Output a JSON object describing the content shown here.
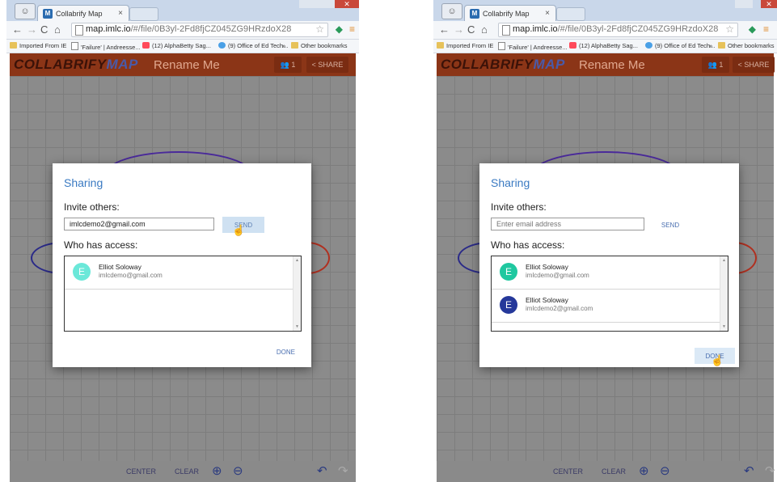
{
  "browser": {
    "tab_title": "Collabrify Map",
    "url_host": "map.imlc.io",
    "url_path": "/#/file/0B3yl-2Fd8fjCZ045ZG9HRzdoX28",
    "bookmarks": [
      "Imported From IE",
      "'Failure' | Andreesse...",
      "(12) AlphaBetty Sag...",
      "(9) Office of Ed Tech...",
      "Other bookmarks"
    ],
    "overflow": "»"
  },
  "app": {
    "logo_prefix": "COLLABRIFY",
    "logo_suffix": "MAP",
    "doc_title": "Rename Me",
    "user_count": "1",
    "share_label": "SHARE",
    "toolbar": {
      "center_label": "CENTER",
      "clear_label": "CLEAR"
    },
    "colors": {
      "header": "#8b3517",
      "accent": "#3a7ac2",
      "ellipse_purple": "#4a2a9a",
      "ellipse_blue": "#2a2a88",
      "ellipse_red": "#b03020"
    }
  },
  "dialog": {
    "title": "Sharing",
    "invite_label": "Invite others:",
    "email_placeholder": "Enter email address",
    "send_label": "SEND",
    "access_label": "Who has access:",
    "done_label": "DONE"
  },
  "left_state": {
    "email_value": "imlcdemo2@gmail.com",
    "people": [
      {
        "initial": "E",
        "name": "Elliot Soloway",
        "email": "imlcdemo@gmail.com",
        "color": "#6be8d9"
      }
    ]
  },
  "right_state": {
    "email_value": "",
    "people": [
      {
        "initial": "E",
        "name": "Elliot Soloway",
        "email": "imlcdemo@gmail.com",
        "color": "#1fc8a0"
      },
      {
        "initial": "E",
        "name": "Elliot Soloway",
        "email": "imlcdemo2@gmail.com",
        "color": "#25389a"
      }
    ]
  }
}
